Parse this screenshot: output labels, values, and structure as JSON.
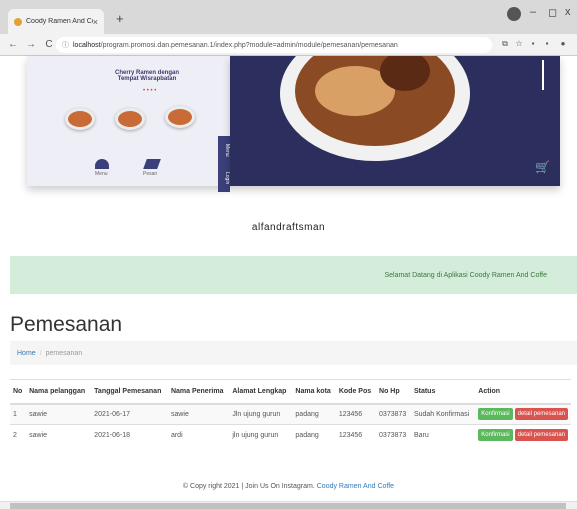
{
  "browser": {
    "tab_title": "Coody Ramen And Coffe",
    "tab_close": "×",
    "new_tab": "+",
    "nav_back": "←",
    "nav_forward": "→",
    "nav_reload": "C",
    "url_host": "localhost",
    "url_path": "/program.promosi.dan.pemesanan.1/index.php?module=admin/module/pemesanan/pemesanan",
    "win_min": "–",
    "win_max": "◻",
    "win_close": "x"
  },
  "hero": {
    "caption": "Cherry Ramen dengan Tempat Wisrapbatan",
    "dots": "• • • •",
    "mini_label_1": "Menu",
    "mini_label_2": "Pesan",
    "side_tab_1": "Menu",
    "side_tab_2": "Login",
    "cart_icon": "🛒"
  },
  "brand": "alfandraftsman",
  "welcome_text": "Selamat Datang di Aplikasi Coody Ramen And Coffe",
  "page_title": "Pemesanan",
  "breadcrumb": {
    "home": "Home",
    "separator": "/",
    "current": "pemesanan"
  },
  "table": {
    "headers": [
      "No",
      "Nama pelanggan",
      "Tanggal Pemesanan",
      "Nama Penerima",
      "Alamat Lengkap",
      "Nama kota",
      "Kode Pos",
      "No Hp",
      "Status",
      "Action"
    ],
    "rows": [
      {
        "no": "1",
        "pelanggan": "sawie",
        "tanggal": "2021-06-17",
        "penerima": "sawie",
        "alamat": "Jln ujung gurun",
        "kota": "padang",
        "kodepos": "123456",
        "hp": "0373873",
        "status": "Sudah Konfirmasi",
        "btn_konfirmasi": "Konfirmasi",
        "btn_detail": "detail pemesanan"
      },
      {
        "no": "2",
        "pelanggan": "sawie",
        "tanggal": "2021-06-18",
        "penerima": "ardi",
        "alamat": "jln ujung gurun",
        "kota": "padang",
        "kodepos": "123456",
        "hp": "0373873",
        "status": "Baru",
        "btn_konfirmasi": "Konfirmasi",
        "btn_detail": "detail pemesanan"
      }
    ]
  },
  "footer": {
    "text": "© Copy right 2021 | Join Us On Instagram",
    "link": "Coody Ramen And Coffe"
  },
  "colors": {
    "success": "#5cb85c",
    "danger": "#d9534f",
    "alert_bg": "#d4edda",
    "hero_dark": "#2c2f5e"
  }
}
